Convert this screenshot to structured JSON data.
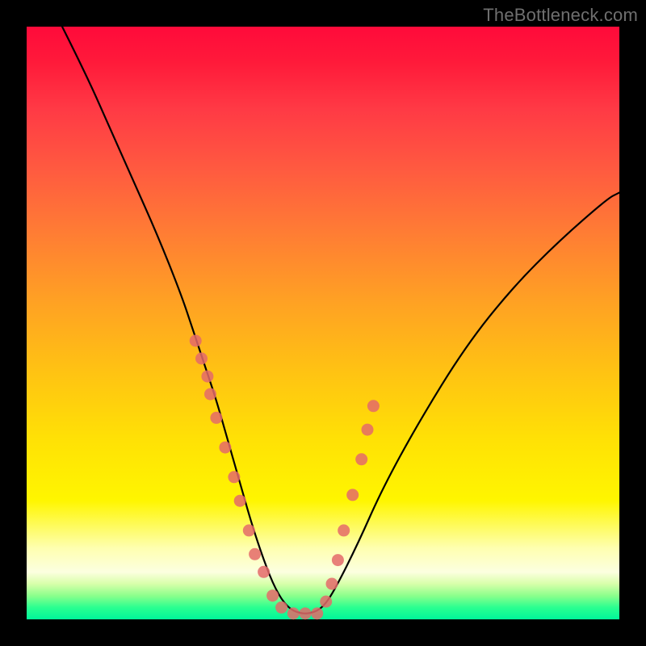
{
  "watermark": "TheBottleneck.com",
  "chart_data": {
    "type": "line",
    "title": "",
    "xlabel": "",
    "ylabel": "",
    "xlim": [
      0,
      100
    ],
    "ylim": [
      0,
      100
    ],
    "series": [
      {
        "name": "bottleneck-curve",
        "x": [
          6,
          10,
          14,
          18,
          22,
          26,
          28,
          30,
          32,
          34,
          36,
          38,
          40,
          42,
          44,
          46,
          48,
          50,
          52,
          56,
          60,
          66,
          74,
          82,
          90,
          98,
          100
        ],
        "y": [
          100,
          92,
          83,
          74,
          65,
          55,
          49,
          43,
          37,
          30,
          23,
          16,
          10,
          5,
          2,
          1,
          1,
          2,
          5,
          13,
          22,
          33,
          46,
          56,
          64,
          71,
          72
        ]
      }
    ],
    "dots": {
      "name": "sample-points",
      "color": "#e46a6a",
      "x": [
        28.5,
        29.5,
        30.5,
        31.0,
        32.0,
        33.5,
        35.0,
        36.0,
        37.5,
        38.5,
        40.0,
        41.5,
        43.0,
        45.0,
        47.0,
        49.0,
        50.5,
        51.5,
        52.5,
        53.5,
        55.0,
        56.5,
        57.5,
        58.5
      ],
      "y": [
        47,
        44,
        41,
        38,
        34,
        29,
        24,
        20,
        15,
        11,
        8,
        4,
        2,
        1,
        1,
        1,
        3,
        6,
        10,
        15,
        21,
        27,
        32,
        36
      ]
    }
  }
}
